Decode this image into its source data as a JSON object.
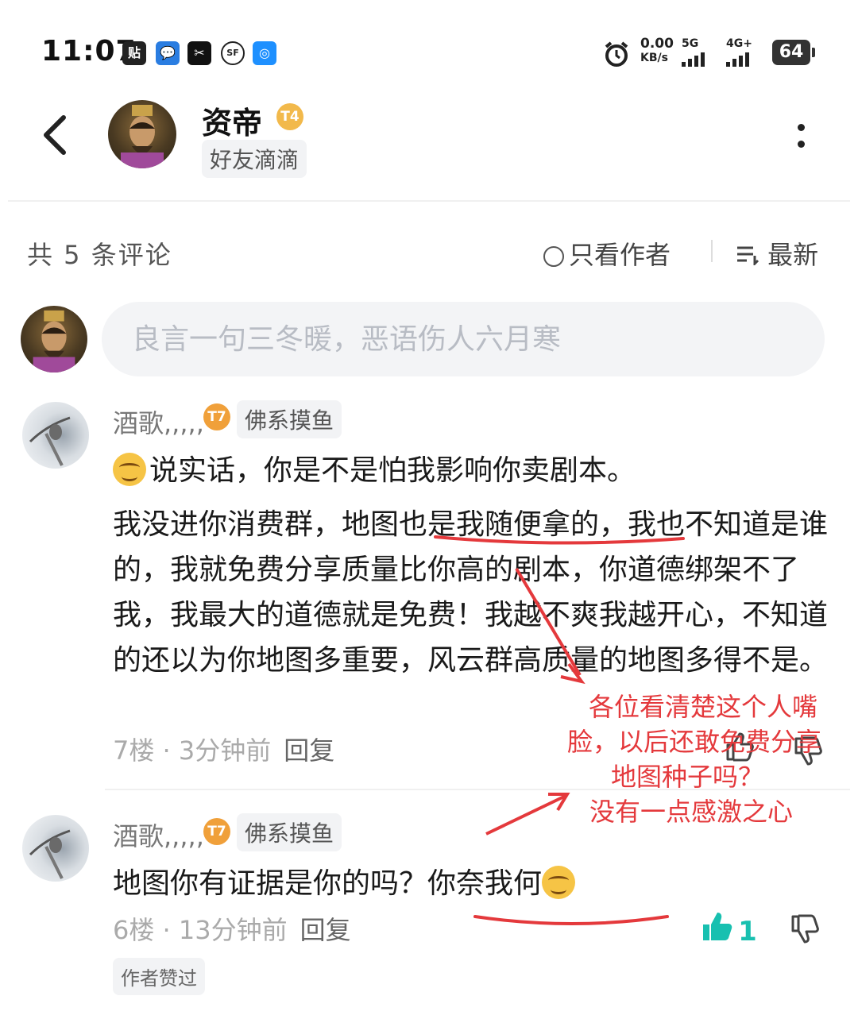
{
  "status_bar": {
    "time": "11:07",
    "app_icons": [
      "贴",
      "💬",
      "✂",
      "SF",
      "◎"
    ],
    "net_speed_top": "0.00",
    "net_speed_bottom": "KB/s",
    "signal1": "5G",
    "signal2": "4G+",
    "battery": "64"
  },
  "header": {
    "username": "资帝",
    "level": "T4",
    "tag": "好友滴滴"
  },
  "comments_bar": {
    "count_label": "共 5 条评论",
    "only_author": "只看作者",
    "sort": "最新"
  },
  "input": {
    "placeholder": "良言一句三冬暖，恶语伤人六月寒"
  },
  "comments": [
    {
      "name": "酒歌,,,,,",
      "level": "T7",
      "tag": "佛系摸鱼",
      "line1": "说实话，你是不是怕我影响你卖剧本。",
      "line2": "我没进你消费群，地图也是我随便拿的，我也不知道是谁的，我就免费分享质量比你高的剧本，你道德绑架不了我，我最大的道德就是免费！我越不爽我越开心，不知道的还以为你地图多重要，风云群高质量的地图多得不是。",
      "floor": "7楼 · 3分钟前",
      "reply": "回复"
    },
    {
      "name": "酒歌,,,,,",
      "level": "T7",
      "tag": "佛系摸鱼",
      "line1": "地图你有证据是你的吗？你奈我何",
      "floor": "6楼 · 13分钟前",
      "reply": "回复",
      "likes": "1",
      "author_liked": "作者赞过"
    }
  ],
  "annotation": {
    "lines": [
      "各位看清楚这个人嘴",
      "脸，以后还敢免费分享",
      "地图种子吗？",
      "没有一点感激之心"
    ],
    "color": "#e4393c"
  },
  "colors": {
    "accent": "#18c0b0",
    "annotation": "#e4393c"
  }
}
